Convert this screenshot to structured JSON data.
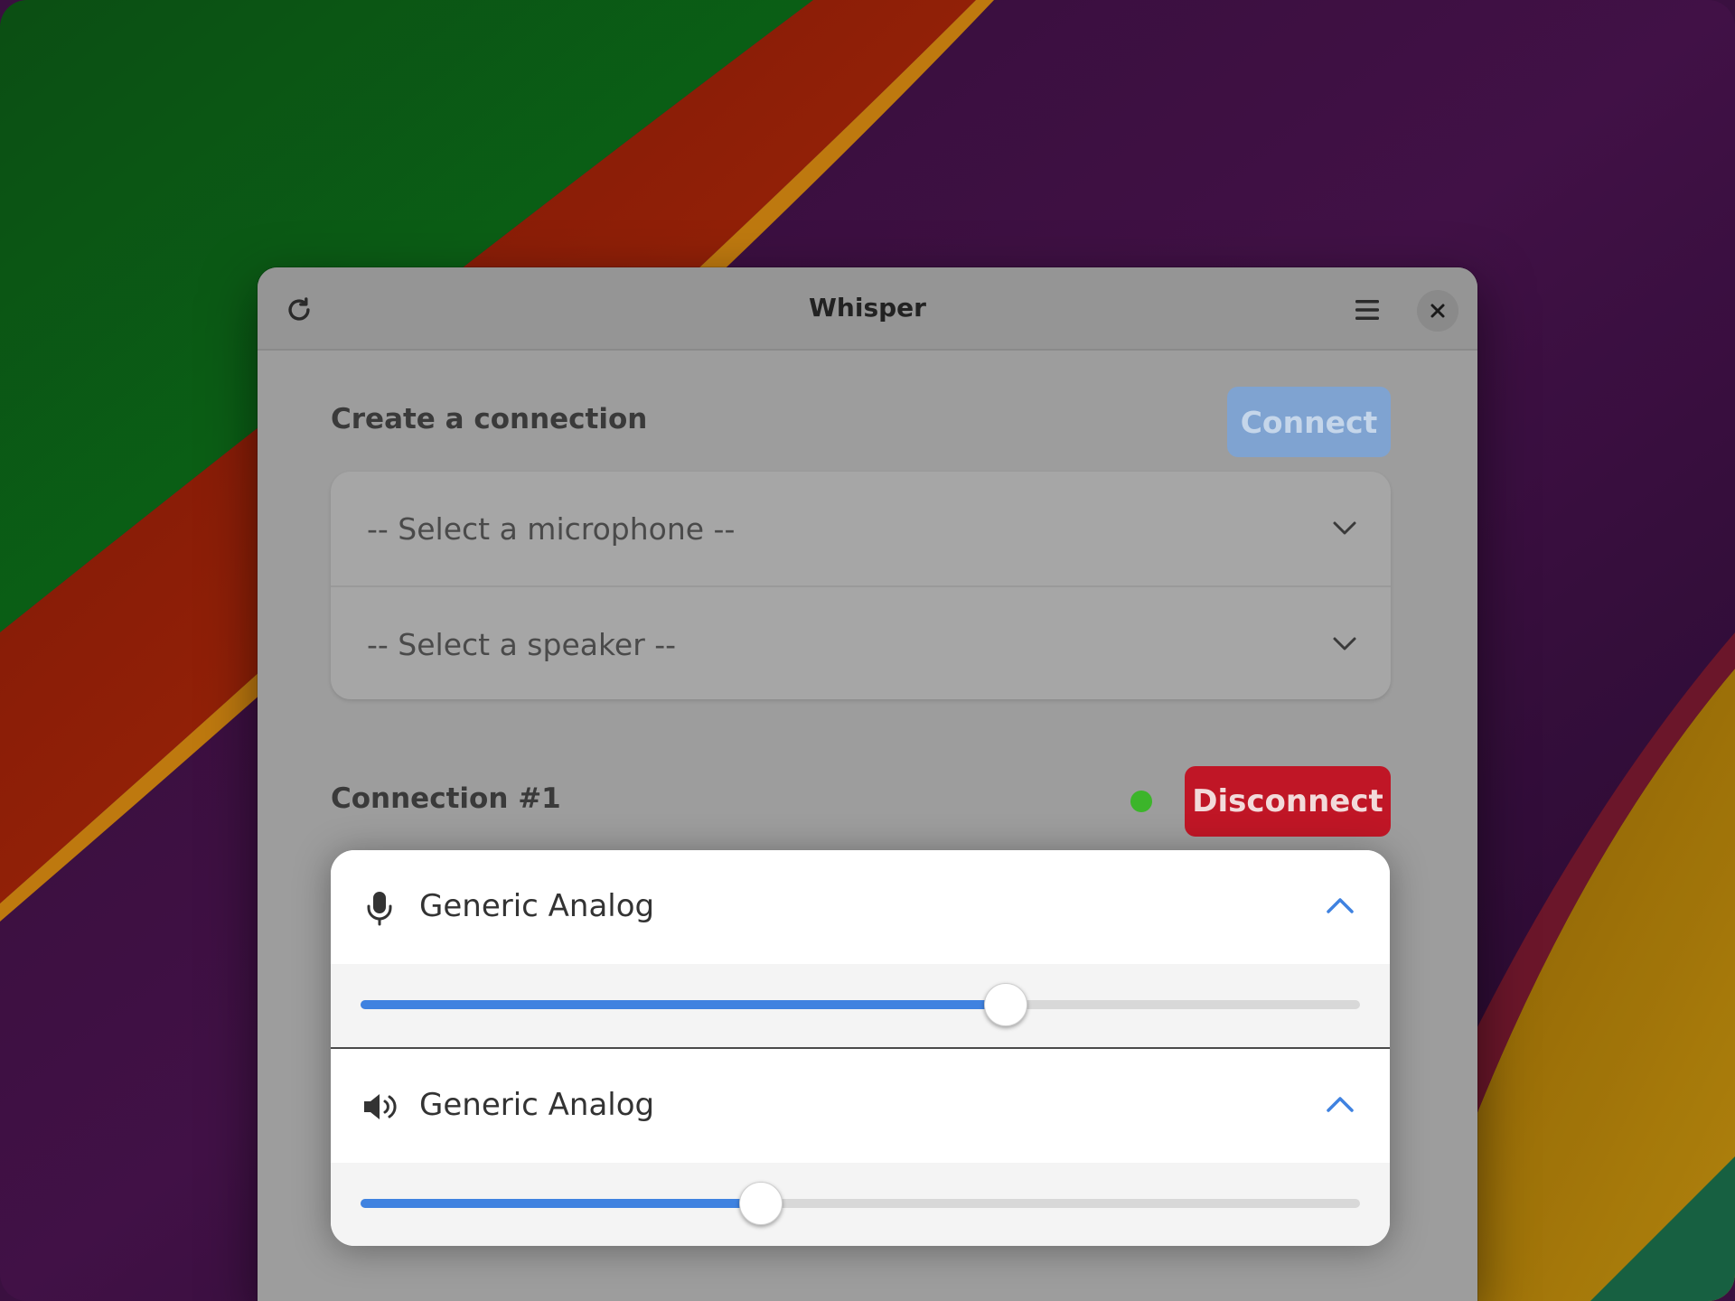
{
  "window": {
    "title": "Whisper"
  },
  "create_section": {
    "title": "Create a connection",
    "connect_label": "Connect",
    "microphone_select": "-- Select a microphone --",
    "speaker_select": "-- Select a speaker --"
  },
  "connection": {
    "title": "Connection #1",
    "status_color": "#3cb52a",
    "disconnect_label": "Disconnect",
    "microphone": {
      "name": "Generic Analog",
      "icon": "microphone-icon",
      "volume_percent": 64.5
    },
    "speaker": {
      "name": "Generic Analog",
      "icon": "speaker-icon",
      "volume_percent": 40
    }
  },
  "colors": {
    "accent": "#3f82e0",
    "destructive": "#c01626",
    "connect_disabled": "#7fa3d1"
  }
}
